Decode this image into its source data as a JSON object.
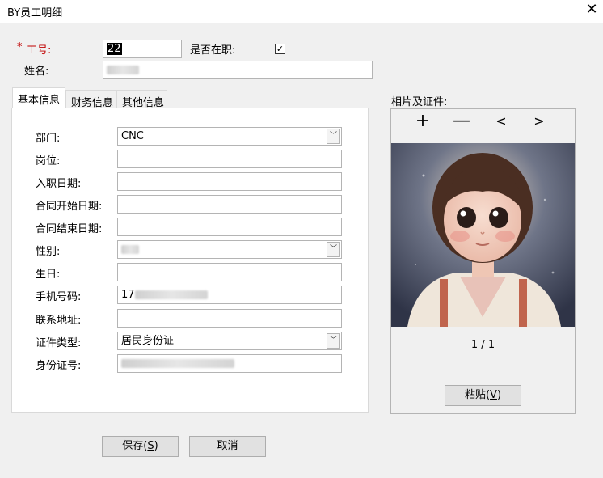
{
  "window": {
    "title": "BY员工明细",
    "close_glyph": "✕"
  },
  "header": {
    "required_mark": "*",
    "emp_no_label": "工号:",
    "emp_no_value": "22",
    "active_label": "是否在职:",
    "active_checked": "✓",
    "name_label": "姓名:",
    "name_value": ""
  },
  "tabs": [
    {
      "label": "基本信息"
    },
    {
      "label": "财务信息"
    },
    {
      "label": "其他信息"
    }
  ],
  "form": {
    "department": {
      "label": "部门:",
      "value": "CNC"
    },
    "position": {
      "label": "岗位:",
      "value": ""
    },
    "hire_date": {
      "label": "入职日期:",
      "value": ""
    },
    "contract_start": {
      "label": "合同开始日期:",
      "value": ""
    },
    "contract_end": {
      "label": "合同结束日期:",
      "value": ""
    },
    "gender": {
      "label": "性别:",
      "value": ""
    },
    "birthday": {
      "label": "生日:",
      "value": ""
    },
    "phone": {
      "label": "手机号码:",
      "value": "17"
    },
    "address": {
      "label": "联系地址:",
      "value": ""
    },
    "id_type": {
      "label": "证件类型:",
      "value": "居民身份证"
    },
    "id_number": {
      "label": "身份证号:",
      "value": ""
    }
  },
  "photo": {
    "section_label": "相片及证件:",
    "add_glyph": "+",
    "remove_glyph": "—",
    "prev_glyph": "<",
    "next_glyph": ">",
    "page_indicator": "1 / 1",
    "paste_button": {
      "label": "粘贴(",
      "hotkey": "V",
      "suffix": ")"
    }
  },
  "footer": {
    "save_button": {
      "label": "保存(",
      "hotkey": "S",
      "suffix": ")"
    },
    "cancel_button": "取消"
  }
}
